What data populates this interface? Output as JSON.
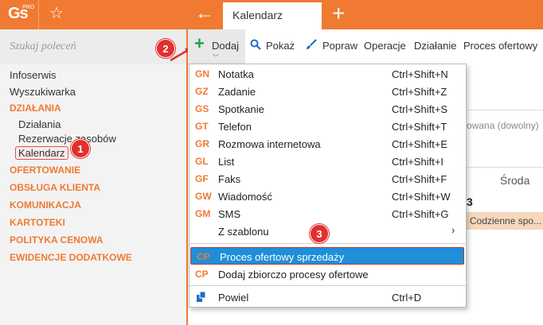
{
  "header": {
    "logo": "Gs",
    "logo_sup": "PRO",
    "tab_title": "Kalendarz"
  },
  "sidebar": {
    "search_placeholder": "Szukaj poleceń",
    "items": [
      {
        "label": "Infoserwis",
        "type": "item"
      },
      {
        "label": "Wyszukiwarka",
        "type": "item"
      },
      {
        "label": "DZIAŁANIA",
        "type": "section"
      },
      {
        "label": "Działania",
        "type": "sub"
      },
      {
        "label": "Rezerwacje zasobów",
        "type": "sub"
      },
      {
        "label": "Kalendarz",
        "type": "sub"
      },
      {
        "label": "OFERTOWANIE",
        "type": "section"
      },
      {
        "label": "OBSŁUGA KLIENTA",
        "type": "section"
      },
      {
        "label": "KOMUNIKACJA",
        "type": "section"
      },
      {
        "label": "KARTOTEKI",
        "type": "section"
      },
      {
        "label": "POLITYKA CENOWA",
        "type": "section"
      },
      {
        "label": "EWIDENCJE DODATKOWE",
        "type": "section"
      }
    ]
  },
  "toolbar": {
    "dodaj": "Dodaj",
    "pokaz": "Pokaż",
    "popraw": "Popraw",
    "operacje": "Operacje",
    "dzialanie": "Działanie",
    "proces": "Proces ofertowy"
  },
  "menu": {
    "items": [
      {
        "code": "GN",
        "label": "Notatka",
        "shortcut": "Ctrl+Shift+N"
      },
      {
        "code": "GZ",
        "label": "Zadanie",
        "shortcut": "Ctrl+Shift+Z"
      },
      {
        "code": "GS",
        "label": "Spotkanie",
        "shortcut": "Ctrl+Shift+S"
      },
      {
        "code": "GT",
        "label": "Telefon",
        "shortcut": "Ctrl+Shift+T"
      },
      {
        "code": "GR",
        "label": "Rozmowa internetowa",
        "shortcut": "Ctrl+Shift+E"
      },
      {
        "code": "GL",
        "label": "List",
        "shortcut": "Ctrl+Shift+I"
      },
      {
        "code": "GF",
        "label": "Faks",
        "shortcut": "Ctrl+Shift+F"
      },
      {
        "code": "GW",
        "label": "Wiadomość",
        "shortcut": "Ctrl+Shift+W"
      },
      {
        "code": "GM",
        "label": "SMS",
        "shortcut": "Ctrl+Shift+G"
      }
    ],
    "template": {
      "label": "Z szablonu",
      "arrow": "›"
    },
    "proces": {
      "code": "CP",
      "label": "Proces ofertowy sprzedaży"
    },
    "zbiorczo": {
      "code": "CP",
      "label": "Dodaj zbiorczo procesy ofertowe"
    },
    "powiel": {
      "label": "Powiel",
      "shortcut": "Ctrl+D"
    }
  },
  "background": {
    "filter_text": "owana (dowolny)",
    "day_name": "Środa",
    "day_number": "3",
    "event": "Codzienne spo..."
  },
  "badges": {
    "one": "1",
    "two": "2",
    "three": "3"
  },
  "colors": {
    "accent": "#f07a32",
    "selection": "#1e8fd8",
    "badge": "#e0302f"
  }
}
